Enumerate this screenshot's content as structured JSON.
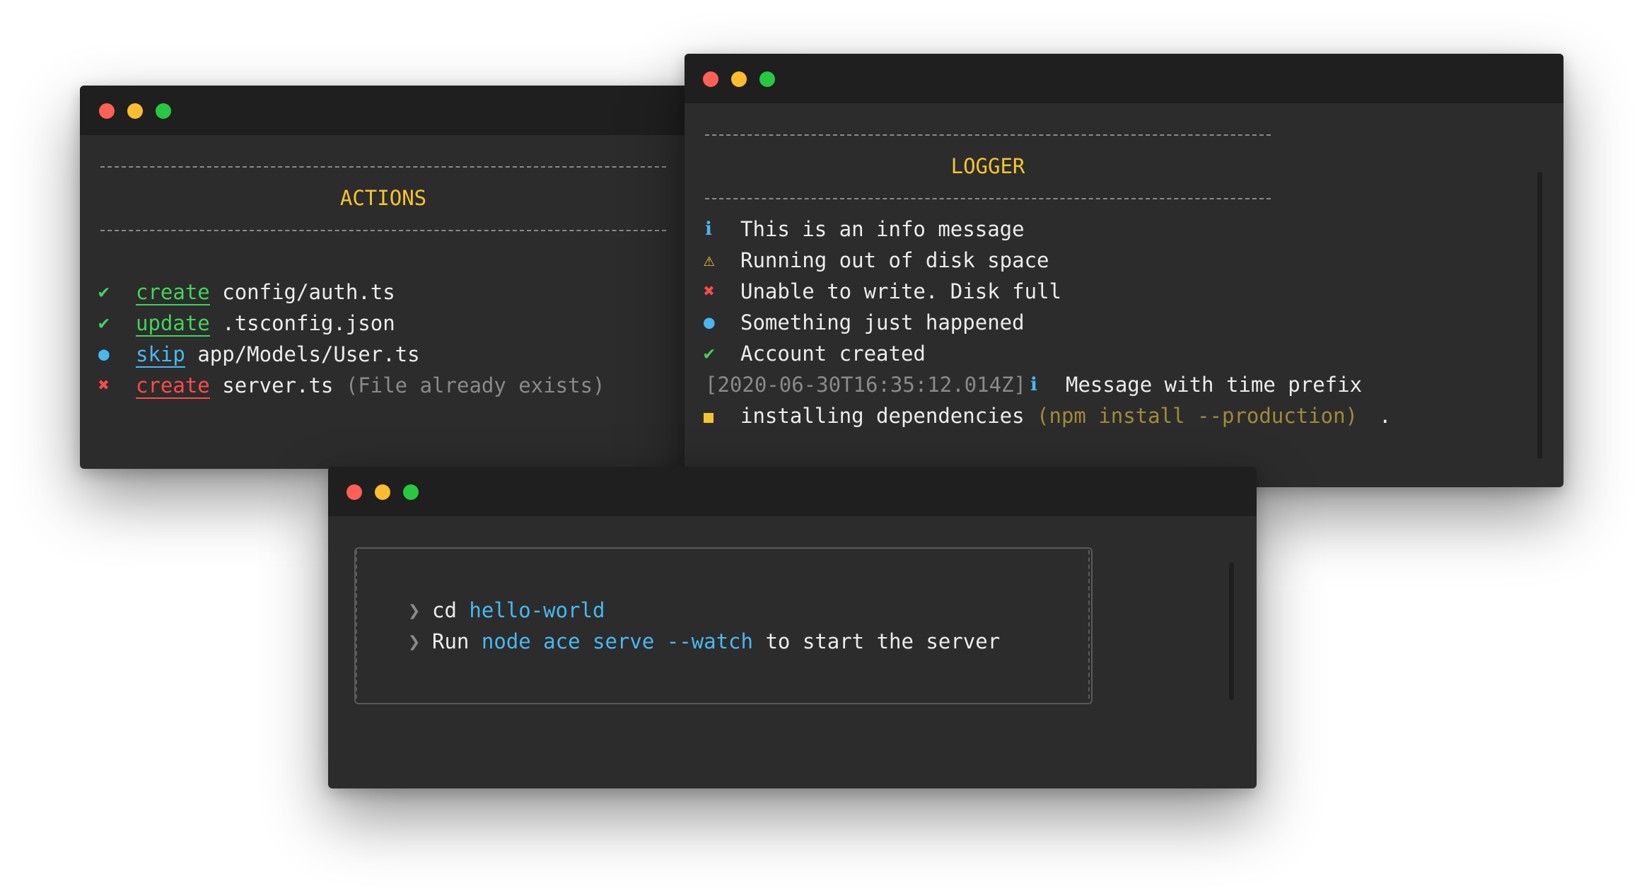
{
  "actions_window": {
    "heading": "ACTIONS",
    "rows": [
      {
        "icon": "✔",
        "action": "create",
        "path": "config/auth.ts",
        "note": ""
      },
      {
        "icon": "✔",
        "action": "update",
        "path": ".tsconfig.json",
        "note": ""
      },
      {
        "icon": "●",
        "action": "skip",
        "path": "app/Models/User.ts",
        "note": ""
      },
      {
        "icon": "✖",
        "action": "create",
        "path": "server.ts",
        "note": "(File already exists)"
      }
    ]
  },
  "logger_window": {
    "heading": "LOGGER",
    "rows": [
      {
        "icon": "ℹ",
        "text": "This is an info message"
      },
      {
        "icon": "⚠",
        "text": "Running out of disk space"
      },
      {
        "icon": "✖",
        "text": "Unable to write. Disk full"
      },
      {
        "icon": "●",
        "text": "Something just happened"
      },
      {
        "icon": "✔",
        "text": "Account created"
      }
    ],
    "timed_row": {
      "timestamp": "[2020-06-30T16:35:12.014Z]",
      "icon": "ℹ",
      "text": "Message with time prefix"
    },
    "progress_row": {
      "text": "installing dependencies",
      "command": "(npm install --production)",
      "spinner": "."
    }
  },
  "instructions_window": {
    "pointer": "❯",
    "line1": {
      "text": "cd",
      "highlight": "hello-world"
    },
    "line2": {
      "prefix": "Run",
      "highlight": "node ace serve --watch",
      "suffix": "to start the server"
    }
  },
  "colors": {
    "success": "#45d15c",
    "info": "#49b8f0",
    "error": "#ff4a4a",
    "warning": "#f4c430",
    "background": "#2c2c2c",
    "titlebar": "#1f1f1f"
  }
}
